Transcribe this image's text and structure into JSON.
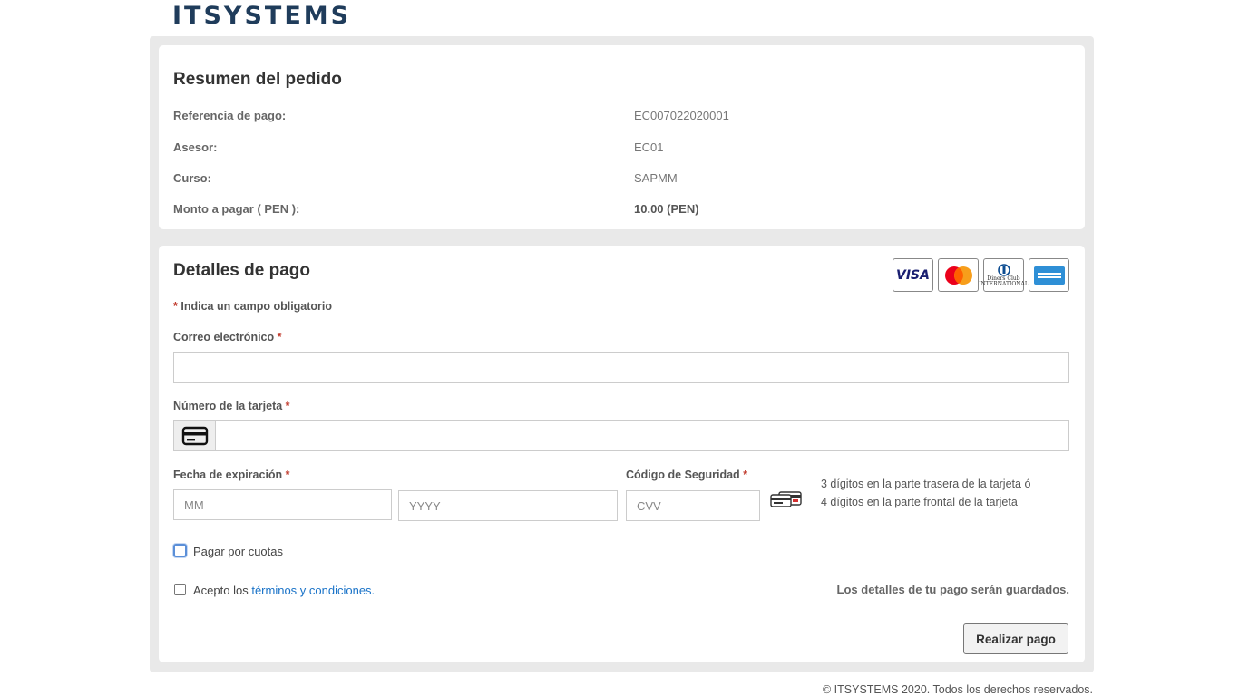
{
  "brand": {
    "logo_text": "ITSYSTEMS"
  },
  "summary": {
    "title": "Resumen del pedido",
    "rows": [
      {
        "label": "Referencia de pago:",
        "value": "EC007022020001"
      },
      {
        "label": "Asesor:",
        "value": "EC01"
      },
      {
        "label": "Curso:",
        "value": "SAPMM"
      },
      {
        "label": "Monto a pagar ( PEN ):",
        "value": "10.00 (PEN)"
      }
    ]
  },
  "payment": {
    "title": "Detalles de pago",
    "card_brands": [
      "visa-logo",
      "mastercard-logo",
      "diners-club-logo",
      "american-express-logo"
    ],
    "visa_text": "VISA",
    "diners_text": "Diners Club INTERNATIONAL",
    "required_note": "Indica un campo obligatorio",
    "required_mark": "*",
    "email": {
      "label": "Correo electrónico",
      "value": "",
      "placeholder": ""
    },
    "card_number": {
      "label": "Número de la tarjeta",
      "value": "",
      "placeholder": "",
      "icon": "credit-card-icon"
    },
    "expiration": {
      "label": "Fecha de expiración",
      "month_placeholder": "MM",
      "year_placeholder": "YYYY"
    },
    "security": {
      "label": "Código de Seguridad",
      "placeholder": "CVV",
      "icon": "cvv-card-icon",
      "hint": "3 dígitos en la parte trasera de la tarjeta ó 4 dígitos en la parte frontal de la tarjeta"
    },
    "installments": {
      "label": "Pagar por cuotas",
      "checked": false
    },
    "terms": {
      "prefix": "Acepto los ",
      "link": "términos y condiciones.",
      "checked": false
    },
    "saved_note": "Los detalles de tu pago serán guardados.",
    "submit_label": "Realizar pago"
  },
  "footer": {
    "text": "© ITSYSTEMS 2020. Todos los derechos reservados."
  },
  "colors": {
    "brand": "#1f3c5b",
    "required": "#c0392b",
    "link": "#1a73c8",
    "panel_bg": "#e9e9e9"
  }
}
